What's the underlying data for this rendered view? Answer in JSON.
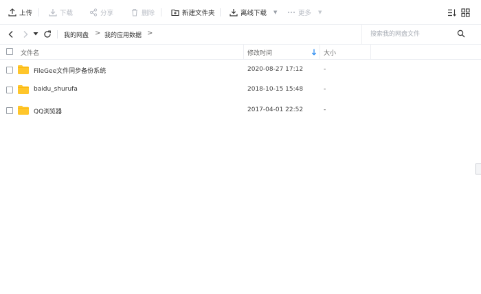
{
  "toolbar": {
    "upload": "上传",
    "download": "下载",
    "share": "分享",
    "delete": "删除",
    "new_folder": "新建文件夹",
    "offline_download": "离线下载",
    "more": "更多"
  },
  "nav": {
    "breadcrumb": [
      "我的网盘",
      "我的应用数据"
    ],
    "separator": ">",
    "search_placeholder": "搜索我的网盘文件"
  },
  "table": {
    "columns": [
      "文件名",
      "修改时间",
      "大小"
    ],
    "rows": [
      {
        "name": "FileGee文件同步备份系统",
        "modified": "2020-08-27 17:12",
        "size": "-"
      },
      {
        "name": "baidu_shurufa",
        "modified": "2018-10-15 15:48",
        "size": "-"
      },
      {
        "name": "QQ浏览器",
        "modified": "2017-04-01 22:52",
        "size": "-"
      }
    ]
  },
  "colors": {
    "folder": "#ffc62b",
    "accent": "#2d8cf0",
    "border": "#eceef2"
  },
  "icons": [
    "upload-icon",
    "download-icon",
    "share-icon",
    "delete-icon",
    "new-folder-icon",
    "offline-download-icon",
    "more-dots-icon",
    "sort-list-icon",
    "grid-view-icon",
    "back-icon",
    "forward-icon",
    "history-dropdown-icon",
    "refresh-icon",
    "search-icon",
    "sort-desc-icon",
    "folder-icon"
  ]
}
